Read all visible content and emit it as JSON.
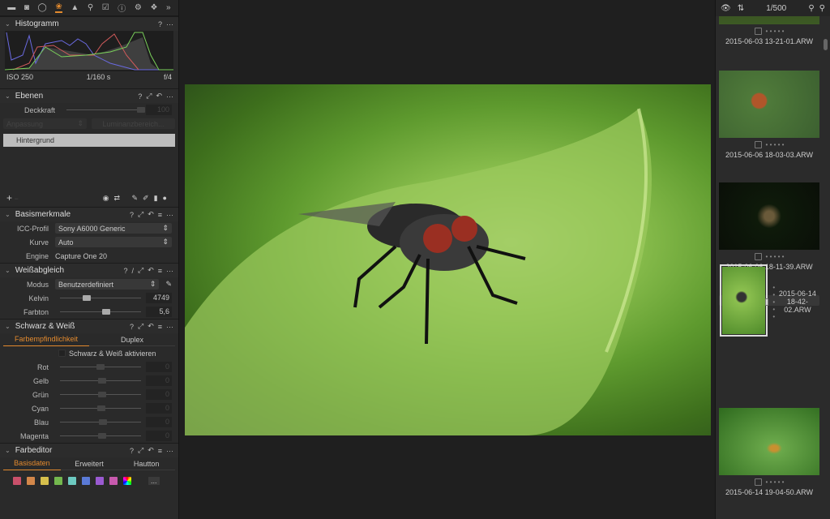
{
  "toolbar": {
    "icons": [
      "folder-icon",
      "camera-icon",
      "lens-icon",
      "color-icon",
      "exposure-icon",
      "details-icon",
      "adjustments-icon",
      "metadata-icon",
      "settings-icon",
      "batch-icon"
    ],
    "expand": "»",
    "active_index": 3,
    "accent": "#e38a2e"
  },
  "histogram": {
    "title": "Histogramm",
    "iso": "ISO 250",
    "shutter": "1/160 s",
    "aperture": "f/4"
  },
  "layers": {
    "title": "Ebenen",
    "opacity_label": "Deckkraft",
    "opacity_value": "100",
    "adjust": "Anpassung",
    "luma": "Luminanzbereich...",
    "layer": "Hintergrund",
    "add": "+",
    "remove": "−"
  },
  "basic": {
    "title": "Basismerkmale",
    "icc_label": "ICC-Profil",
    "icc": "Sony A6000 Generic",
    "curve_label": "Kurve",
    "curve": "Auto",
    "engine_label": "Engine",
    "engine": "Capture One 20"
  },
  "wb": {
    "title": "Weißabgleich",
    "mode_label": "Modus",
    "mode": "Benutzerdefiniert",
    "kelvin_label": "Kelvin",
    "kelvin": "4749",
    "tint_label": "Farbton",
    "tint": "5,6"
  },
  "bw": {
    "title": "Schwarz & Weiß",
    "tab1": "Farbempfindlichkeit",
    "tab2": "Duplex",
    "enable": "Schwarz & Weiß aktivieren",
    "sliders": [
      {
        "label": "Rot",
        "value": "0"
      },
      {
        "label": "Gelb",
        "value": "0"
      },
      {
        "label": "Grün",
        "value": "0"
      },
      {
        "label": "Cyan",
        "value": "0"
      },
      {
        "label": "Blau",
        "value": "0"
      },
      {
        "label": "Magenta",
        "value": "0"
      }
    ]
  },
  "coloreditor": {
    "title": "Farbeditor",
    "tab1": "Basisdaten",
    "tab2": "Erweitert",
    "tab3": "Hautton",
    "swatches": [
      "#c9506a",
      "#d3874a",
      "#d6bf4c",
      "#74b84e",
      "#6cc9c0",
      "#5a7ad6",
      "#9a5ad1",
      "#c85aae"
    ],
    "more": "..."
  },
  "browser": {
    "counter": "1/500",
    "items": [
      {
        "filename": "2015-06-03 13-21-01.ARW"
      },
      {
        "filename": "2015-06-06 18-03-03.ARW"
      },
      {
        "filename": "2015-06-06 18-11-39.ARW"
      },
      {
        "filename": "2015-06-14 18-42-02.ARW",
        "selected": true
      },
      {
        "filename": "2015-06-14 19-04-50.ARW"
      }
    ]
  }
}
